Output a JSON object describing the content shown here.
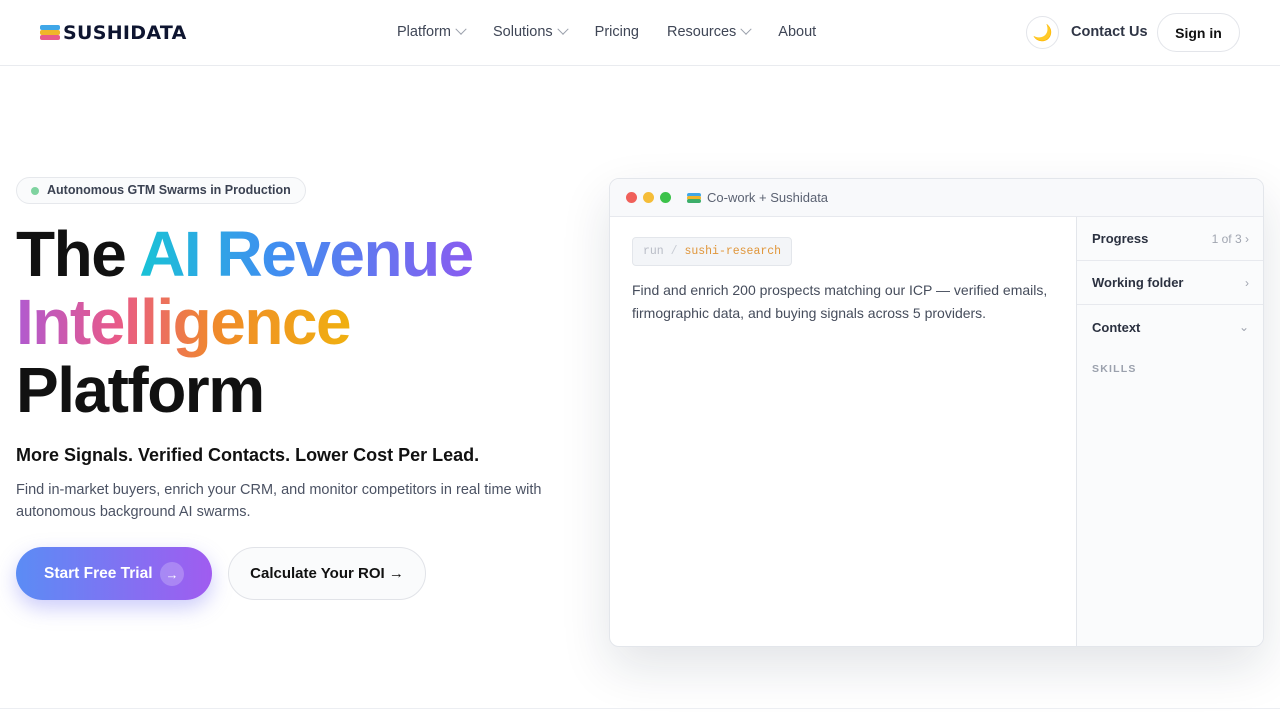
{
  "brand": {
    "name": "SUSHIDATA"
  },
  "nav": {
    "items": [
      {
        "label": "Platform",
        "has_dropdown": true
      },
      {
        "label": "Solutions",
        "has_dropdown": true
      },
      {
        "label": "Pricing",
        "has_dropdown": false
      },
      {
        "label": "Resources",
        "has_dropdown": true
      },
      {
        "label": "About",
        "has_dropdown": false
      }
    ],
    "theme_toggle_icon": "moon-icon",
    "contact_label": "Contact Us",
    "signin_label": "Sign in"
  },
  "hero": {
    "badge": "Autonomous GTM Swarms in Production",
    "title_part1": "The ",
    "title_part2": "AI Revenue",
    "title_part3": "Intelligence",
    "title_part4": "Platform",
    "subtitle": "More Signals. Verified Contacts. Lower Cost Per Lead.",
    "description": "Find in-market buyers, enrich your CRM, and monitor competitors in real time with autonomous background AI swarms.",
    "cta_primary": "Start Free Trial",
    "cta_primary_icon": "arrow-right-icon",
    "cta_secondary": "Calculate Your ROI →"
  },
  "demo_window": {
    "title": "Co-work + Sushidata",
    "command_keyword": "run",
    "command_separator": "/",
    "command_value": "sushi-research",
    "prompt": "Find and enrich 200 prospects matching our ICP — verified emails, firmographic data, and buying signals across 5 providers.",
    "sidebar": {
      "progress_label": "Progress",
      "progress_value": "1 of 3",
      "working_folder_label": "Working folder",
      "context_label": "Context",
      "skills_label": "SKILLS"
    }
  },
  "colors": {
    "accent_start": "#5b8cf5",
    "accent_end": "#a05cf0",
    "badge_dot": "#7fd3a0"
  }
}
